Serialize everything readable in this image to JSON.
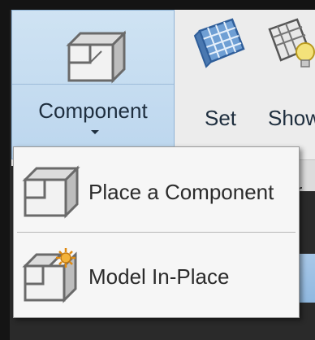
{
  "ribbon": {
    "component": {
      "label": "Component",
      "icon": "component-box-icon"
    },
    "set": {
      "label": "Set",
      "icon": "workplane-grid-icon"
    },
    "show": {
      "label": "Show",
      "icon": "show-workplane-icon"
    },
    "strip_text": "r"
  },
  "menu": {
    "items": [
      {
        "label": "Place a Component",
        "icon": "place-component-icon"
      },
      {
        "label": "Model In-Place",
        "icon": "model-in-place-icon"
      }
    ]
  },
  "colors": {
    "accent": "#bcd6ee",
    "border": "#8fb3d6"
  }
}
